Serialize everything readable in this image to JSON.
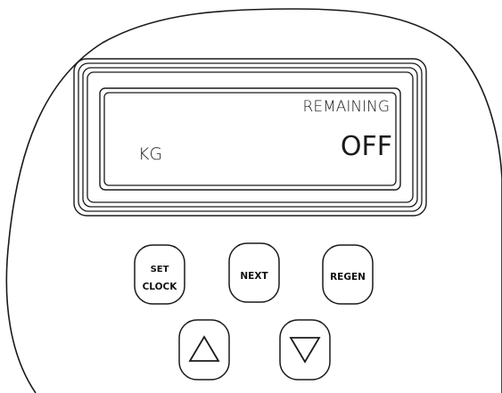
{
  "display": {
    "header_label": "REMAINING",
    "unit_label": "KG",
    "value": "OFF"
  },
  "buttons": {
    "set_clock": {
      "line1": "SET",
      "line2": "CLOCK"
    },
    "next": {
      "label": "NEXT"
    },
    "regen": {
      "label": "REGEN"
    },
    "up": {
      "icon": "triangle-up-icon"
    },
    "down": {
      "icon": "triangle-down-icon"
    }
  },
  "colors": {
    "outline": "#1a1a1a",
    "background": "#ffffff"
  }
}
